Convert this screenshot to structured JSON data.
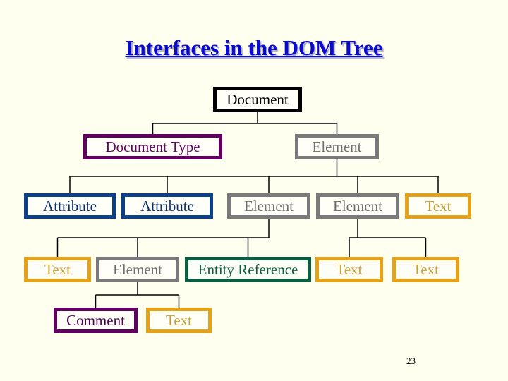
{
  "title": "Interfaces in the DOM Tree",
  "page_number": "23",
  "colors": {
    "background": "#fffff0",
    "title": "#0a0ad0",
    "Document": "#000000",
    "DocumentType": "#620062",
    "Element": "#7a7a7a",
    "Attribute": "#0c3f8a",
    "Text": "#e3a21a",
    "EntityReference": "#0b5e42",
    "Comment": "#620062"
  },
  "tree": {
    "nodes": [
      {
        "id": "n-document",
        "label": "Document",
        "type": "Document",
        "parent": null
      },
      {
        "id": "n-doctype",
        "label": "Document Type",
        "type": "DocumentType",
        "parent": "n-document"
      },
      {
        "id": "n-element-root",
        "label": "Element",
        "type": "Element",
        "parent": "n-document"
      },
      {
        "id": "n-attr-1",
        "label": "Attribute",
        "type": "Attribute",
        "parent": "n-element-root"
      },
      {
        "id": "n-attr-2",
        "label": "Attribute",
        "type": "Attribute",
        "parent": "n-element-root"
      },
      {
        "id": "n-element-a",
        "label": "Element",
        "type": "Element",
        "parent": "n-element-root"
      },
      {
        "id": "n-element-b",
        "label": "Element",
        "type": "Element",
        "parent": "n-element-root"
      },
      {
        "id": "n-text-r3",
        "label": "Text",
        "type": "Text",
        "parent": "n-element-root"
      },
      {
        "id": "n-text-r4a",
        "label": "Text",
        "type": "Text",
        "parent": "n-element-a"
      },
      {
        "id": "n-element-c",
        "label": "Element",
        "type": "Element",
        "parent": "n-element-a"
      },
      {
        "id": "n-entityref",
        "label": "Entity Reference",
        "type": "EntityReference",
        "parent": "n-element-a"
      },
      {
        "id": "n-text-r4b",
        "label": "Text",
        "type": "Text",
        "parent": "n-element-b"
      },
      {
        "id": "n-text-r4c",
        "label": "Text",
        "type": "Text",
        "parent": "n-element-b"
      },
      {
        "id": "n-comment",
        "label": "Comment",
        "type": "Comment",
        "parent": "n-element-c"
      },
      {
        "id": "n-text-r5",
        "label": "Text",
        "type": "Text",
        "parent": "n-element-c"
      }
    ]
  }
}
